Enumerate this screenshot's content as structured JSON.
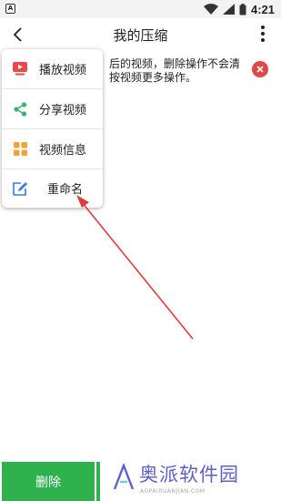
{
  "status_bar": {
    "left_icon_letter": "A",
    "time": "4:21",
    "icons": [
      "wifi-icon",
      "signal-icon",
      "battery-icon"
    ]
  },
  "header": {
    "title": "我的压缩"
  },
  "notice": {
    "line1": "后的视频，删除操作不会清",
    "line2": "按视频更多操作。"
  },
  "menu": {
    "items": [
      {
        "label": "播放视频",
        "icon": "play-video-icon",
        "color": "#e84a4a"
      },
      {
        "label": "分享视频",
        "icon": "share-icon",
        "color": "#3bb36a"
      },
      {
        "label": "视频信息",
        "icon": "info-grid-icon",
        "color": "#f0a23a"
      },
      {
        "label": "重命名",
        "icon": "edit-icon",
        "color": "#3a7de0"
      }
    ]
  },
  "bottom": {
    "delete_label": "删除"
  },
  "watermark": {
    "text": "奥派软件园",
    "url": "AOPAIRUANJIAN.COM"
  },
  "colors": {
    "accent_green": "#2fb24d",
    "close_red": "#e04848",
    "arrow_red": "#e03c3c",
    "watermark_purple": "#5f5fc8"
  }
}
